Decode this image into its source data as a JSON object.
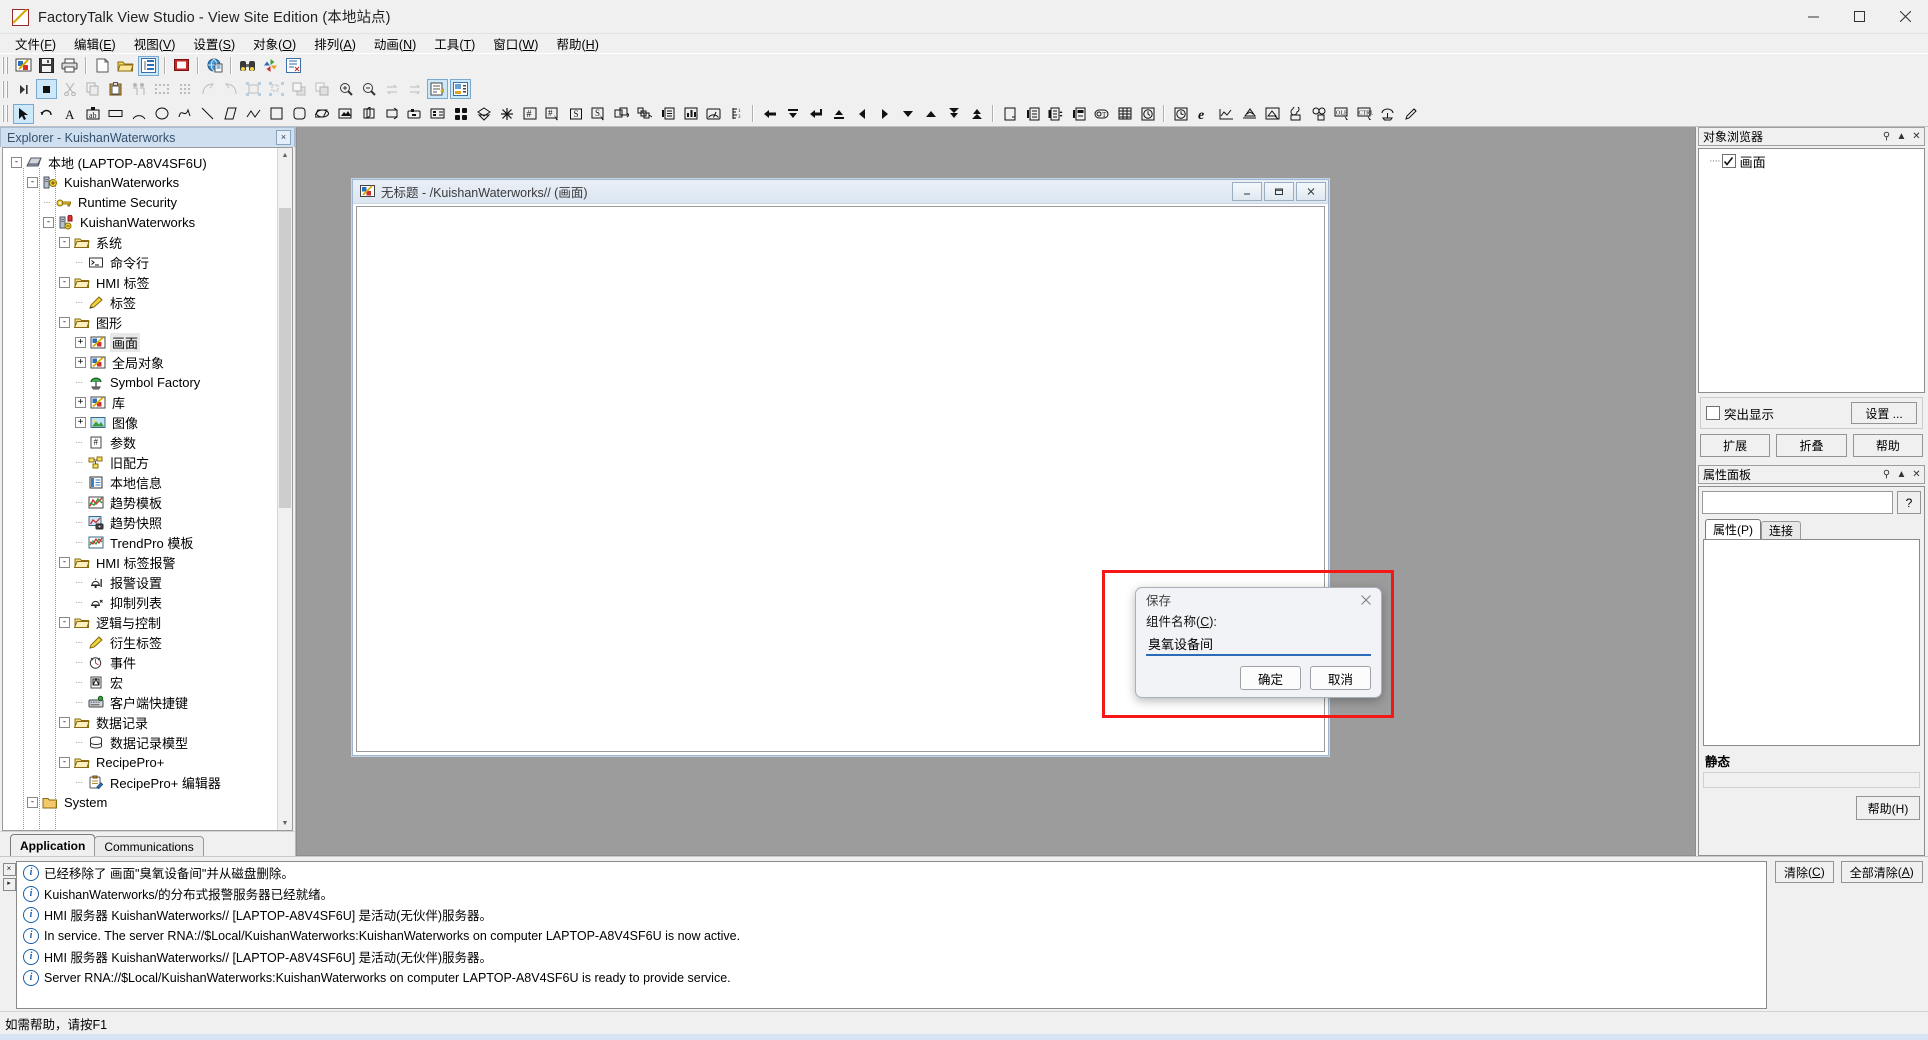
{
  "window": {
    "title": "FactoryTalk View Studio - View Site Edition  (本地站点)",
    "minimize": "—",
    "maximize": "□",
    "close": "✕"
  },
  "menubar": [
    {
      "label": "文件",
      "key": "F"
    },
    {
      "label": "编辑",
      "key": "E"
    },
    {
      "label": "视图",
      "key": "V"
    },
    {
      "label": "设置",
      "key": "S"
    },
    {
      "label": "对象",
      "key": "O"
    },
    {
      "label": "排列",
      "key": "A"
    },
    {
      "label": "动画",
      "key": "N"
    },
    {
      "label": "工具",
      "key": "T"
    },
    {
      "label": "窗口",
      "key": "W"
    },
    {
      "label": "帮助",
      "key": "H"
    }
  ],
  "toolbar_standard": [
    "new-display-icon",
    "save-icon",
    "print-icon",
    "new-file-icon",
    "open-folder-icon",
    "explorer-toggle-icon",
    "stop-icon",
    "web-globe-icon",
    "binoculars-icon",
    "refresh-icon",
    "diagnostics-icon"
  ],
  "toolbar_objects": [
    "run-icon",
    "stop-test-icon",
    "cut-icon",
    "copy-icon",
    "paste-icon",
    "group-icon",
    "dotted-list-icon",
    "dots-grid-icon",
    "bend-icon",
    "unbend-icon",
    "group-objects-icon",
    "ungroup-objects-icon",
    "bring-front-icon",
    "send-back-icon",
    "zoom-in-icon",
    "zoom-out-icon",
    "redo-arrows-icon",
    "undo-arrows-icon",
    "properties-icon",
    "object-explorer-icon"
  ],
  "toolbar_drawing": [
    "select-arrow-icon",
    "rotate-icon",
    "text-icon",
    "text-box-icon",
    "rectangle-flat-icon",
    "arc-icon",
    "ellipse-icon",
    "freehand-icon",
    "line-icon",
    "parallelogram-icon",
    "polyline-icon",
    "square-icon",
    "rounded-rect-icon",
    "oval-icon",
    "image-icon",
    "panel-icon",
    "wedge-icon",
    "push-button-icon",
    "display-list-icon",
    "grid-buttons-icon",
    "diamond-valve-icon",
    "snowflake-icon",
    "numeric-input-icon",
    "numeric-input-cursor-icon",
    "string-display-icon",
    "string-input-icon",
    "object-group-icon",
    "object-scatter-icon",
    "list-indicator-icon",
    "bar-graph-icon",
    "gauge-icon",
    "scale-icon",
    "arrow-left-icon",
    "arrow-down-bar-icon",
    "arrow-left-bar-icon",
    "arrow-up-bar-icon",
    "arrow-prev-icon",
    "arrow-next-icon",
    "arrow-down-icon",
    "arrow-up-icon",
    "arrow-down-double-icon",
    "arrow-up-double-icon",
    "page-icon",
    "list-page-icon",
    "list-scroll-icon",
    "list-select-icon",
    "time-field-icon",
    "table-icon",
    "clock-icon",
    "clock2-icon",
    "internet-explorer-icon",
    "trend-icon",
    "alarm-banner-icon",
    "alarm-summary-icon",
    "recipe-icon",
    "diagnostics-list-icon",
    "ole-object-icon",
    "activex-control-icon",
    "symbol-factory-icon",
    "pencil-icon"
  ],
  "explorer": {
    "header": "Explorer - KuishanWaterworks",
    "close_label": "×",
    "tree": [
      {
        "depth": 0,
        "expander": "-",
        "icon": "local-computer-icon",
        "label": "本地 (LAPTOP-A8V4SF6U)",
        "selected": false
      },
      {
        "depth": 1,
        "expander": "-",
        "icon": "application-icon",
        "label": "KuishanWaterworks",
        "selected": false
      },
      {
        "depth": 2,
        "expander": "",
        "icon": "key-icon",
        "label": "Runtime Security",
        "selected": false
      },
      {
        "depth": 2,
        "expander": "-",
        "icon": "hmi-server-icon",
        "label": "KuishanWaterworks",
        "selected": false
      },
      {
        "depth": 3,
        "expander": "-",
        "icon": "folder-icon",
        "label": "系统",
        "selected": false
      },
      {
        "depth": 4,
        "expander": "",
        "icon": "command-line-icon",
        "label": "命令行",
        "selected": false
      },
      {
        "depth": 3,
        "expander": "-",
        "icon": "folder-icon",
        "label": "HMI 标签",
        "selected": false
      },
      {
        "depth": 4,
        "expander": "",
        "icon": "tag-pencil-icon",
        "label": "标签",
        "selected": false
      },
      {
        "depth": 3,
        "expander": "-",
        "icon": "folder-icon",
        "label": "图形",
        "selected": false
      },
      {
        "depth": 4,
        "expander": "+",
        "icon": "display-icon",
        "label": "画面",
        "selected": true
      },
      {
        "depth": 4,
        "expander": "+",
        "icon": "display-icon",
        "label": "全局对象",
        "selected": false
      },
      {
        "depth": 4,
        "expander": "",
        "icon": "symbol-factory-icon",
        "label": "Symbol Factory",
        "selected": false
      },
      {
        "depth": 4,
        "expander": "+",
        "icon": "display-icon",
        "label": "库",
        "selected": false
      },
      {
        "depth": 4,
        "expander": "+",
        "icon": "image-icon",
        "label": "图像",
        "selected": false
      },
      {
        "depth": 4,
        "expander": "",
        "icon": "parameter-icon",
        "label": "参数",
        "selected": false
      },
      {
        "depth": 4,
        "expander": "",
        "icon": "recipe-icon",
        "label": "旧配方",
        "selected": false
      },
      {
        "depth": 4,
        "expander": "",
        "icon": "local-message-icon",
        "label": "本地信息",
        "selected": false
      },
      {
        "depth": 4,
        "expander": "",
        "icon": "trend-template-icon",
        "label": "趋势模板",
        "selected": false
      },
      {
        "depth": 4,
        "expander": "",
        "icon": "trend-snapshot-icon",
        "label": "趋势快照",
        "selected": false
      },
      {
        "depth": 4,
        "expander": "",
        "icon": "trendpro-icon",
        "label": "TrendPro 模板",
        "selected": false
      },
      {
        "depth": 3,
        "expander": "-",
        "icon": "folder-icon",
        "label": "HMI 标签报警",
        "selected": false
      },
      {
        "depth": 4,
        "expander": "",
        "icon": "alarm-setup-icon",
        "label": "报警设置",
        "selected": false
      },
      {
        "depth": 4,
        "expander": "",
        "icon": "suppress-list-icon",
        "label": "抑制列表",
        "selected": false
      },
      {
        "depth": 3,
        "expander": "-",
        "icon": "folder-icon",
        "label": "逻辑与控制",
        "selected": false
      },
      {
        "depth": 4,
        "expander": "",
        "icon": "derived-tag-icon",
        "label": "衍生标签",
        "selected": false
      },
      {
        "depth": 4,
        "expander": "",
        "icon": "event-clock-icon",
        "label": "事件",
        "selected": false
      },
      {
        "depth": 4,
        "expander": "",
        "icon": "macro-icon",
        "label": "宏",
        "selected": false
      },
      {
        "depth": 4,
        "expander": "",
        "icon": "client-keys-icon",
        "label": "客户端快捷键",
        "selected": false
      },
      {
        "depth": 3,
        "expander": "-",
        "icon": "folder-icon",
        "label": "数据记录",
        "selected": false
      },
      {
        "depth": 4,
        "expander": "",
        "icon": "datalog-model-icon",
        "label": "数据记录模型",
        "selected": false
      },
      {
        "depth": 3,
        "expander": "-",
        "icon": "folder-icon",
        "label": "RecipePro+",
        "selected": false
      },
      {
        "depth": 4,
        "expander": "",
        "icon": "recipepro-editor-icon",
        "label": "RecipePro+ 编辑器",
        "selected": false
      },
      {
        "depth": 1,
        "expander": "-",
        "icon": "folder-plain-icon",
        "label": "System",
        "selected": false
      }
    ],
    "tabs": [
      {
        "label": "Application",
        "active": true
      },
      {
        "label": "Communications",
        "active": false
      }
    ]
  },
  "document": {
    "icon": "display-icon",
    "title": "无标题 - /KuishanWaterworks// (画面)",
    "minimize": "—",
    "restore": "❐",
    "close": "✕"
  },
  "save_dialog": {
    "title": "保存",
    "close": "✕",
    "field_label": "组件名称",
    "field_label_key": "C",
    "field_label_suffix": ":",
    "value": "臭氧设备间",
    "ok": "确定",
    "cancel": "取消",
    "highlight_color": "#f51616",
    "underline_color": "#2b6cb8"
  },
  "object_explorer": {
    "title": "对象浏览器",
    "pin": "⚲",
    "collapse": "▲",
    "close": "✕",
    "nodes": [
      {
        "label": "画面",
        "checked": true
      }
    ],
    "highlight_label": "突出显示",
    "highlight_checked": false,
    "settings_button": "设置 ...",
    "expand_button": "扩展",
    "collapse_button": "折叠",
    "help_button": "帮助"
  },
  "property_panel": {
    "title": "属性面板",
    "pin": "⚲",
    "collapse": "▲",
    "close": "✕",
    "combo_value": "",
    "help_icon": "?",
    "tabs": [
      {
        "label": "属性(P)",
        "active": true
      },
      {
        "label": "连接",
        "active": false
      }
    ],
    "static_label": "静态",
    "help_button": "帮助(H)"
  },
  "messages": {
    "close": "×",
    "scroll": "▸",
    "items": [
      {
        "icon": "info-icon",
        "text": "已经移除了 画面\"臭氧设备间\"并从磁盘删除。"
      },
      {
        "icon": "info-icon",
        "text": "KuishanWaterworks/的分布式报警服务器已经就绪。"
      },
      {
        "icon": "info-icon",
        "text": "HMI 服务器 KuishanWaterworks// [LAPTOP-A8V4SF6U] 是活动(无伙伴)服务器。"
      },
      {
        "icon": "info-icon",
        "text": "In service. The server RNA://$Local/KuishanWaterworks:KuishanWaterworks on computer LAPTOP-A8V4SF6U is now active."
      },
      {
        "icon": "info-icon",
        "text": "HMI 服务器 KuishanWaterworks// [LAPTOP-A8V4SF6U] 是活动(无伙伴)服务器。"
      },
      {
        "icon": "info-icon",
        "text": "Server RNA://$Local/KuishanWaterworks:KuishanWaterworks on computer LAPTOP-A8V4SF6U is ready to provide service."
      }
    ],
    "clear_button": "清除(C)",
    "clear_all_button": "全部清除(A)"
  },
  "statusbar": {
    "text": "如需帮助，请按F1"
  }
}
